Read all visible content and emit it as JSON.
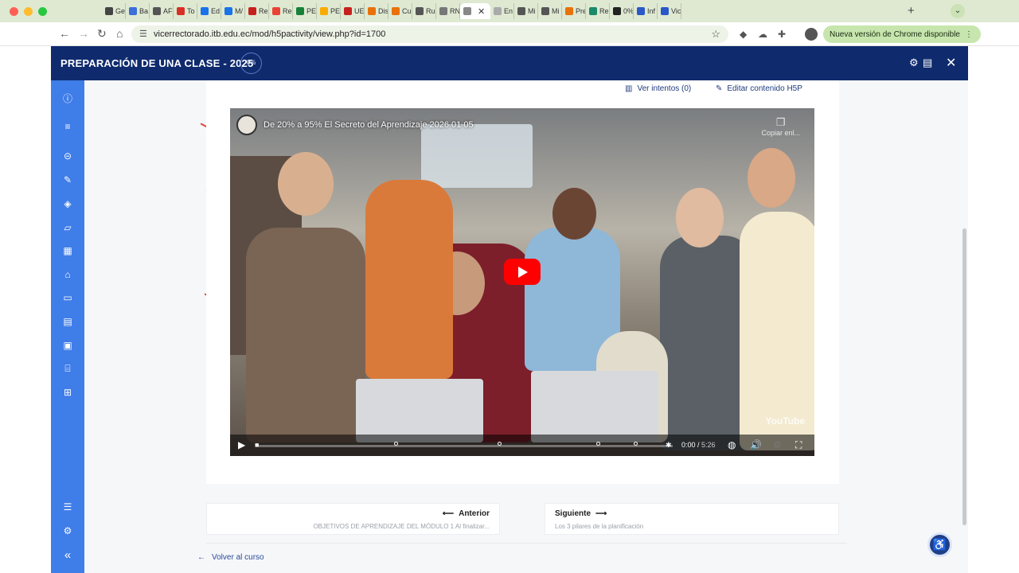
{
  "browser": {
    "tabs": [
      {
        "label": "Ge",
        "color": "#444444"
      },
      {
        "label": "Ba",
        "color": "#3b6fd9"
      },
      {
        "label": "AF",
        "color": "#555555"
      },
      {
        "label": "To",
        "color": "#d93025"
      },
      {
        "label": "Ed",
        "color": "#1a73e8"
      },
      {
        "label": "M/",
        "color": "#1a73e8"
      },
      {
        "label": "Re",
        "color": "#c5221f"
      },
      {
        "label": "Re",
        "color": "#ea4335"
      },
      {
        "label": "PE",
        "color": "#188038"
      },
      {
        "label": "PE",
        "color": "#f9ab00"
      },
      {
        "label": "UE",
        "color": "#c5221f"
      },
      {
        "label": "Dis",
        "color": "#e8710a"
      },
      {
        "label": "Cu",
        "color": "#e8710a"
      },
      {
        "label": "Ru",
        "color": "#555555"
      },
      {
        "label": "RN",
        "color": "#777777"
      },
      {
        "label": "",
        "color": "#888888",
        "active": true
      },
      {
        "label": "En",
        "color": "#aaaaaa"
      },
      {
        "label": "Mi",
        "color": "#555555"
      },
      {
        "label": "Mi",
        "color": "#555555"
      },
      {
        "label": "Pre",
        "color": "#e8710a"
      },
      {
        "label": "Re",
        "color": "#1a8a6a"
      },
      {
        "label": "0%",
        "color": "#222222"
      },
      {
        "label": "Inf",
        "color": "#2b58c7"
      },
      {
        "label": "Vic",
        "color": "#2b58c7"
      }
    ],
    "url": "vicerrectorado.itb.edu.ec/mod/h5pactivity/view.php?id=1700",
    "update_label": "Nueva versión de Chrome disponible"
  },
  "header": {
    "title": "PREPARACIÓN DE UNA CLASE - 2025",
    "progress": "0%"
  },
  "content": {
    "attempts_label": "Ver intentos (0)",
    "edit_label": "Editar contenido H5P"
  },
  "video": {
    "title": "De 20% a 95% El Secreto del Aprendizaje 2026 01 05",
    "copy_label": "Copiar enl...",
    "time_current": "0:00",
    "time_total": "5:26",
    "brand": "YouTube",
    "chapters": [
      0.33,
      0.58,
      0.82,
      0.91
    ]
  },
  "navigation": {
    "prev_label": "Anterior",
    "prev_sub": "OBJETIVOS DE APRENDIZAJE DEL MÓDULO 1 Al finalizar...",
    "next_label": "Siguiente",
    "next_sub": "Los 3 pilares de la planificación",
    "back_label": "Volver al curso"
  }
}
